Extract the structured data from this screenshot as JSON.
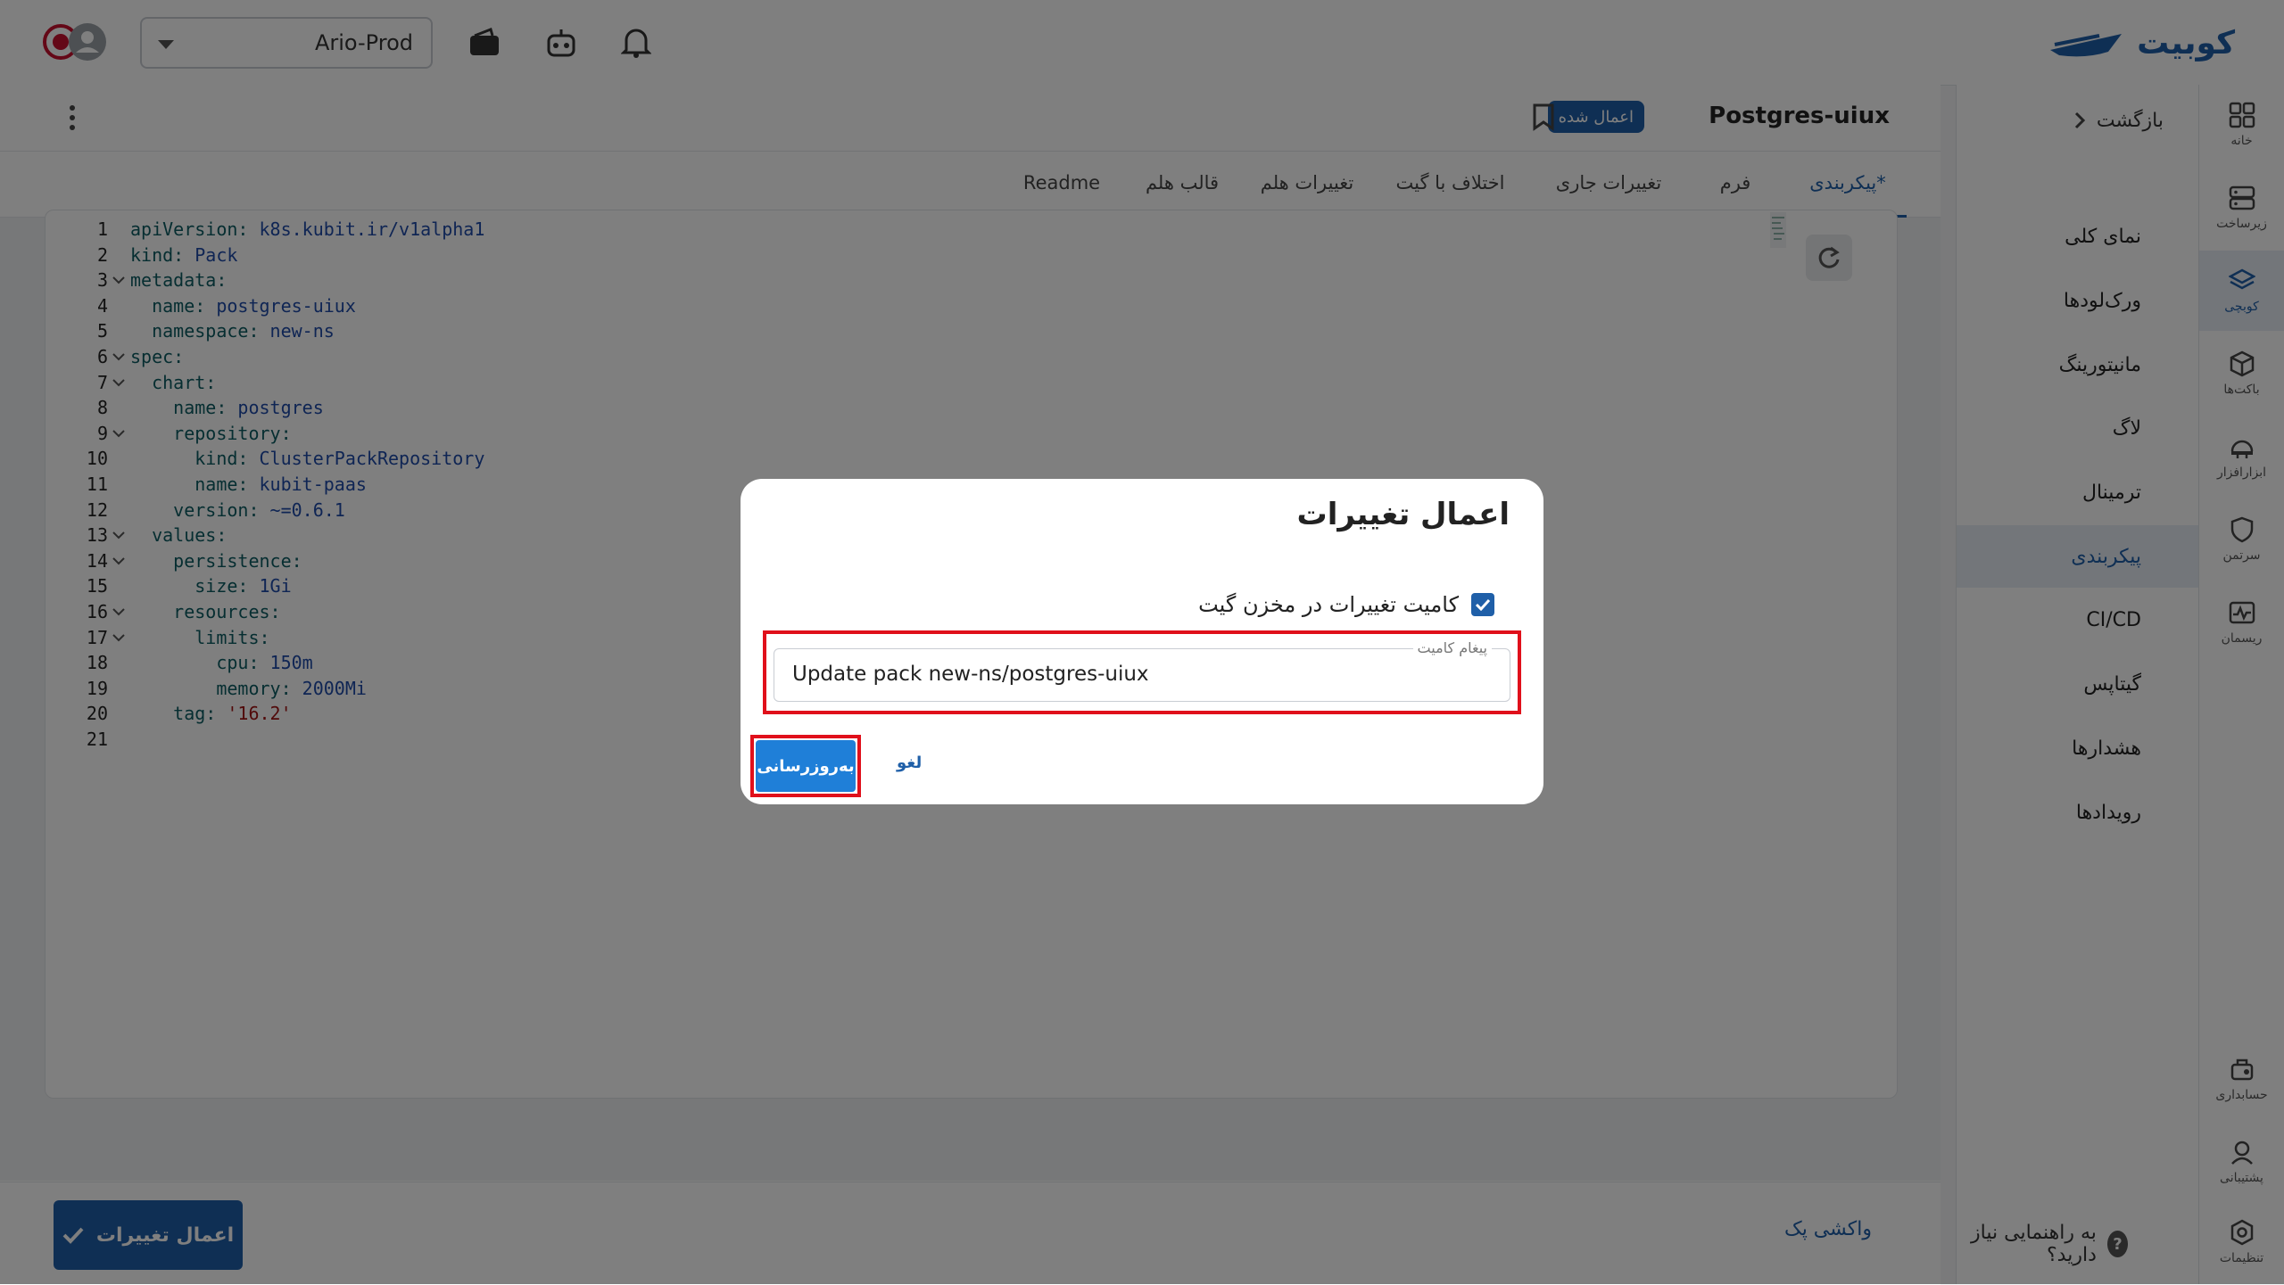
{
  "topbar": {
    "logo_text": "کوبیت",
    "cluster": "Ario-Prod"
  },
  "iconbar": {
    "items": [
      {
        "label": "خانه",
        "icon": "grid-icon"
      },
      {
        "label": "زیرساخت",
        "icon": "server-icon"
      },
      {
        "label": "کوبچی",
        "icon": "layers-icon"
      },
      {
        "label": "باکت‌ها",
        "icon": "box-icon"
      },
      {
        "label": "ابزارافزار",
        "icon": "tool-icon"
      },
      {
        "label": "سرتمن",
        "icon": "shield-icon"
      },
      {
        "label": "ریسمان",
        "icon": "activity-icon"
      }
    ],
    "bottom_items": [
      {
        "label": "حسابداری",
        "icon": "accounting-icon"
      },
      {
        "label": "پشتیبانی",
        "icon": "support-icon"
      },
      {
        "label": "تنظیمات",
        "icon": "settings-icon"
      }
    ]
  },
  "subnav": {
    "back_label": "بازگشت",
    "items": [
      {
        "label": "نمای کلی"
      },
      {
        "label": "ورک‌لودها"
      },
      {
        "label": "مانیتورینگ"
      },
      {
        "label": "لاگ"
      },
      {
        "label": "ترمینال"
      },
      {
        "label": "پیکربندی"
      },
      {
        "label": "CI/CD"
      },
      {
        "label": "گیتاپس"
      },
      {
        "label": "هشدارها"
      },
      {
        "label": "رویدادها"
      }
    ],
    "help_label": "به راهنمایی نیاز دارید؟"
  },
  "main": {
    "title": "Postgres-uiux",
    "status_badge": "اعمال شده",
    "tabs": [
      {
        "label": "*پیکربندی"
      },
      {
        "label": "فرم"
      },
      {
        "label": "تغییرات جاری"
      },
      {
        "label": "اختلاف با گیت"
      },
      {
        "label": "تغییرات هلم"
      },
      {
        "label": "قالب هلم"
      },
      {
        "label": "Readme"
      }
    ],
    "code_lines": [
      {
        "n": "1",
        "k": "apiVersion:",
        "v": " k8s.kubit.ir/v1alpha1"
      },
      {
        "n": "2",
        "k": "kind:",
        "v": " Pack"
      },
      {
        "n": "3",
        "k": "metadata:",
        "v": ""
      },
      {
        "n": "4",
        "k": "  name:",
        "v": " postgres-uiux"
      },
      {
        "n": "5",
        "k": "  namespace:",
        "v": " new-ns"
      },
      {
        "n": "6",
        "k": "spec:",
        "v": ""
      },
      {
        "n": "7",
        "k": "  chart:",
        "v": ""
      },
      {
        "n": "8",
        "k": "    name:",
        "v": " postgres"
      },
      {
        "n": "9",
        "k": "    repository:",
        "v": ""
      },
      {
        "n": "10",
        "k": "      kind:",
        "v": " ClusterPackRepository"
      },
      {
        "n": "11",
        "k": "      name:",
        "v": " kubit-paas"
      },
      {
        "n": "12",
        "k": "    version:",
        "v": " ~=0.6.1"
      },
      {
        "n": "13",
        "k": "  values:",
        "v": ""
      },
      {
        "n": "14",
        "k": "    persistence:",
        "v": ""
      },
      {
        "n": "15",
        "k": "      size:",
        "v": " 1Gi"
      },
      {
        "n": "16",
        "k": "    resources:",
        "v": ""
      },
      {
        "n": "17",
        "k": "      limits:",
        "v": ""
      },
      {
        "n": "18",
        "k": "        cpu:",
        "v": " 150m"
      },
      {
        "n": "19",
        "k": "        memory:",
        "v": " 2000Mi"
      },
      {
        "n": "20",
        "k": "    tag:",
        "v": " '16.2'"
      },
      {
        "n": "21",
        "k": "",
        "v": ""
      }
    ],
    "apply_button": "اعمال تغییرات",
    "fetch_link": "واکشی پک"
  },
  "dialog": {
    "title": "اعمال تغییرات",
    "checkbox_label": "کامیت تغییرات در مخزن گیت",
    "field_label": "پیغام کامیت",
    "field_value": "Update pack new-ns/postgres-uiux",
    "update_button": "به‌روزرسانی",
    "cancel_button": "لغو"
  }
}
